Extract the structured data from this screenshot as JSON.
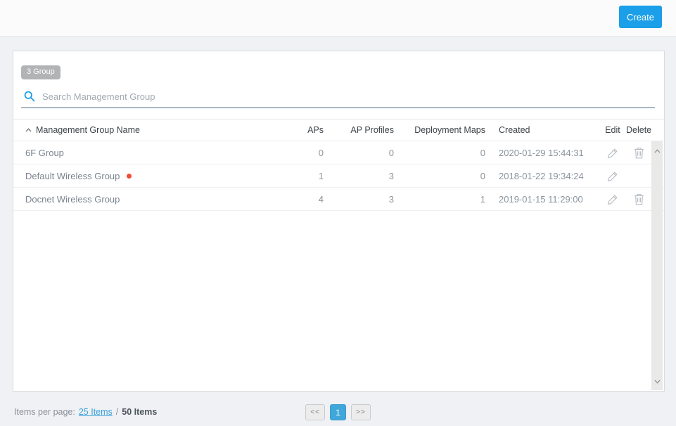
{
  "header": {
    "create_button": "Create"
  },
  "toolbar": {
    "group_count_badge": "3 Group",
    "search_placeholder": "Search Management Group"
  },
  "table": {
    "columns": {
      "name": "Management Group Name",
      "aps": "APs",
      "profiles": "AP Profiles",
      "maps": "Deployment Maps",
      "created": "Created",
      "edit": "Edit",
      "delete": "Delete"
    },
    "rows": [
      {
        "name": "6F Group",
        "aps": "0",
        "profiles": "0",
        "maps": "0",
        "created": "2020-01-29 15:44:31"
      },
      {
        "name": "Default Wireless Group",
        "aps": "1",
        "profiles": "3",
        "maps": "0",
        "created": "2018-01-22 19:34:24"
      },
      {
        "name": "Docnet Wireless Group",
        "aps": "4",
        "profiles": "3",
        "maps": "1",
        "created": "2019-01-15 11:29:00"
      }
    ]
  },
  "pagination": {
    "items_per_page_label": "Items per page:",
    "items_per_page_link": "25 Items",
    "separator": "/",
    "total_items": "50 Items",
    "prev_label": "<<",
    "current_page": "1",
    "next_label": ">>"
  },
  "colors": {
    "accent_blue": "#1b9fe8",
    "pagination_active": "#41a7da",
    "alert_dot": "#f04b33",
    "badge_gray": "#b1b3b5"
  }
}
